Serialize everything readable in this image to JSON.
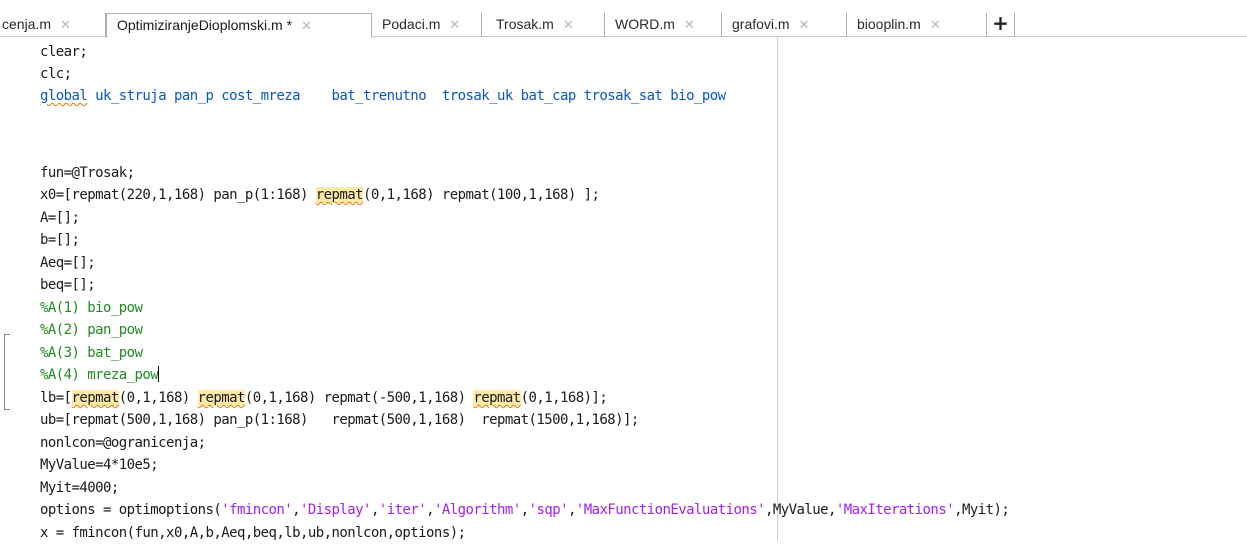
{
  "tabs": [
    {
      "label": "cenja.m",
      "close": "✕"
    },
    {
      "label": "OptimiziranjeDioplomski.m *",
      "close": "✕",
      "active": true
    },
    {
      "label": "Podaci.m",
      "close": "✕"
    },
    {
      "label": "Trosak.m",
      "close": "✕"
    },
    {
      "label": "WORD.m",
      "close": "✕"
    },
    {
      "label": "grafovi.m",
      "close": "✕"
    },
    {
      "label": "biooplin.m",
      "close": "✕"
    }
  ],
  "new_tab": "+",
  "code": {
    "l1": "clear;",
    "l2": "clc;",
    "l3_kw": "global",
    "l3_rest": " uk_struja pan_p cost_mreza    bat_trenutno  trosak_uk bat_cap trosak_sat bio_pow",
    "l6": "fun=@Trosak;",
    "l7_a": "x0=[repmat(220,1,168) pan_p(1:168) ",
    "l7_b": "repmat",
    "l7_c": "(0,1,168) repmat(100,1,168) ];",
    "l8": "A=[];",
    "l9": "b=[];",
    "l10": "Aeq=[];",
    "l11": "beq=[];",
    "l12": "%A(1) bio_pow",
    "l13": "%A(2) pan_pow",
    "l14": "%A(3) bat_pow",
    "l15": "%A(4) mreza_pow",
    "l16_a": "lb=[",
    "l16_b": "repmat",
    "l16_c": "(0,1,168) ",
    "l16_d": "repmat",
    "l16_e": "(0,1,168) repmat(-500,1,168) ",
    "l16_f": "repmat",
    "l16_g": "(0,1,168)];",
    "l17": "ub=[repmat(500,1,168) pan_p(1:168)   repmat(500,1,168)  repmat(1500,1,168)];",
    "l18": "nonlcon=@ogranicenja;",
    "l19": "MyValue=4*10e5;",
    "l20": "Myit=4000;",
    "l21_a": "options = optimoptions(",
    "l21_s1": "'fmincon'",
    "l21_c1": ",",
    "l21_s2": "'Display'",
    "l21_c2": ",",
    "l21_s3": "'iter'",
    "l21_c3": ",",
    "l21_s4": "'Algorithm'",
    "l21_c4": ",",
    "l21_s5": "'sqp'",
    "l21_c5": ",",
    "l21_s6": "'MaxFunctionEvaluations'",
    "l21_c6": ",MyValue,",
    "l21_s7": "'MaxIterations'",
    "l21_c7": ",Myit);",
    "l22": "x = fmincon(fun,x0,A,b,Aeq,beq,lb,ub,nonlcon,options);"
  }
}
